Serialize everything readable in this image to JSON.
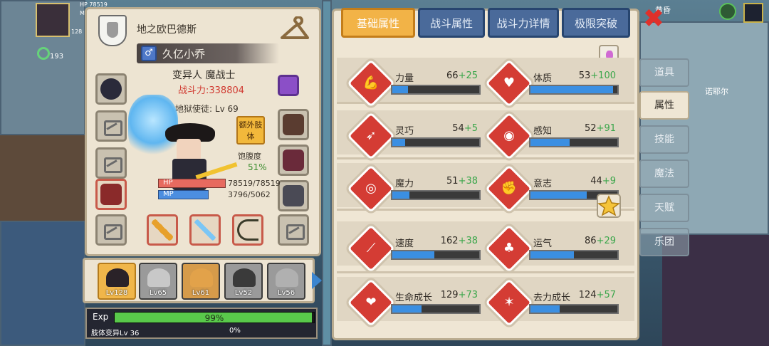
{
  "hud": {
    "hp_label": "HP",
    "hp_value": "78519",
    "mp_label": "M",
    "lv_value": "128",
    "coin_value": "193",
    "top_right_text": "黄昏",
    "place_label": "诺耶尔"
  },
  "character": {
    "guild_name": "地之欧巴德斯",
    "gender_symbol": "♂",
    "name": "久亿小乔",
    "class_name": "变异人 魔战士",
    "power": "战斗力:338804",
    "rank": "A阶 地狱使徒: Lv 69",
    "extra_button": "额外肢体",
    "satiety_label": "饱腹度",
    "satiety_value": "51%",
    "hp_label": "HP",
    "hp_value": "78519/78519",
    "hp_fraction": 1.0,
    "mp_label": "MP",
    "mp_value": "3796/5062",
    "mp_fraction": 0.75
  },
  "party": [
    {
      "lv": "Lv128",
      "active": true
    },
    {
      "lv": "Lv65",
      "active": false
    },
    {
      "lv": "Lv61",
      "active": false
    },
    {
      "lv": "Lv52",
      "active": false
    },
    {
      "lv": "Lv56",
      "active": false
    }
  ],
  "exp": {
    "label": "Exp",
    "percent_text": "99%",
    "fraction": 0.99,
    "sub_label": "肢体变异Lv 36",
    "sub_percent": "0%"
  },
  "tabs": [
    {
      "label": "基础属性",
      "active": true
    },
    {
      "label": "战斗属性",
      "active": false
    },
    {
      "label": "战斗力详情",
      "active": false
    },
    {
      "label": "极限突破",
      "active": false
    }
  ],
  "attributes": [
    {
      "name": "力量",
      "base": "66",
      "bonus": "+25",
      "fill": 0.18,
      "icon": "muscle-icon",
      "glyph": "💪"
    },
    {
      "name": "体质",
      "base": "53",
      "bonus": "+100",
      "fill": 0.95,
      "icon": "body-icon",
      "glyph": "♥"
    },
    {
      "name": "灵巧",
      "base": "54",
      "bonus": "+5",
      "fill": 0.15,
      "icon": "running-icon",
      "glyph": "➶"
    },
    {
      "name": "感知",
      "base": "52",
      "bonus": "+91",
      "fill": 0.45,
      "icon": "eye-icon",
      "glyph": "◉"
    },
    {
      "name": "魔力",
      "base": "51",
      "bonus": "+38",
      "fill": 0.2,
      "icon": "magic-swirl-icon",
      "glyph": "◎"
    },
    {
      "name": "意志",
      "base": "44",
      "bonus": "+9",
      "fill": 0.65,
      "icon": "will-icon",
      "glyph": "✊"
    },
    {
      "name": "速度",
      "base": "162",
      "bonus": "+38",
      "fill": 0.48,
      "icon": "speed-icon",
      "glyph": "⟋"
    },
    {
      "name": "运气",
      "base": "86",
      "bonus": "+29",
      "fill": 0.5,
      "icon": "clover-icon",
      "glyph": "♣"
    },
    {
      "name": "生命成长",
      "base": "129",
      "bonus": "+73",
      "fill": 0.34,
      "icon": "life-growth-icon",
      "glyph": "❤"
    },
    {
      "name": "去力成长",
      "base": "124",
      "bonus": "+57",
      "fill": 0.34,
      "icon": "power-growth-icon",
      "glyph": "✶"
    }
  ],
  "side_menu": [
    {
      "label": "道具",
      "active": false
    },
    {
      "label": "属性",
      "active": true
    },
    {
      "label": "技能",
      "active": false
    },
    {
      "label": "魔法",
      "active": false
    },
    {
      "label": "天赋",
      "active": false
    },
    {
      "label": "乐团",
      "active": false
    }
  ],
  "close_symbol": "✖"
}
